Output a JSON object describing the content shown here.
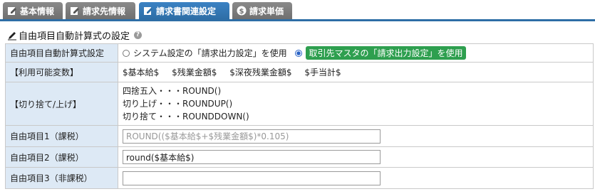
{
  "tabs": [
    {
      "label": "基本情報",
      "icon": "edit-icon",
      "active": false
    },
    {
      "label": "請求先情報",
      "icon": "edit-icon",
      "active": false
    },
    {
      "label": "請求書関連設定",
      "icon": "edit-icon",
      "active": true
    },
    {
      "label": "請求単価",
      "icon": "dollar-icon",
      "active": false
    }
  ],
  "section": {
    "title": "自由項目自動計算式の設定",
    "help": "?"
  },
  "rows": {
    "formula_setting": {
      "label": "自由項目自動計算式設定",
      "option_system": "システム設定の「請求出力設定」を使用",
      "option_master": "取引先マスタの「請求出力設定」を使用",
      "selected": "master"
    },
    "variables": {
      "label": "【利用可能変数】",
      "items": [
        "$基本給$",
        "$残業金額$",
        "$深夜残業金額$",
        "$手当計$"
      ]
    },
    "rounding": {
      "label": "【切り捨て/上げ】",
      "lines": [
        "四捨五入・・・ROUND()",
        "切り上げ・・・ROUNDUP()",
        "切り捨て・・・ROUNDDOWN()"
      ]
    },
    "item1": {
      "label": "自由項目1（課税）",
      "value": "",
      "placeholder": "ROUND(($基本給$+$残業金額$)*0.105)"
    },
    "item2": {
      "label": "自由項目2（課税）",
      "value": "round($基本給$)",
      "placeholder": ""
    },
    "item3": {
      "label": "自由項目3（非課税）",
      "value": "",
      "placeholder": ""
    }
  },
  "colors": {
    "active_tab": "#2e6ea6",
    "inactive_tab": "#7a7a7a",
    "label_bg": "#dde9f5",
    "selected_badge": "#2e9f4f"
  }
}
